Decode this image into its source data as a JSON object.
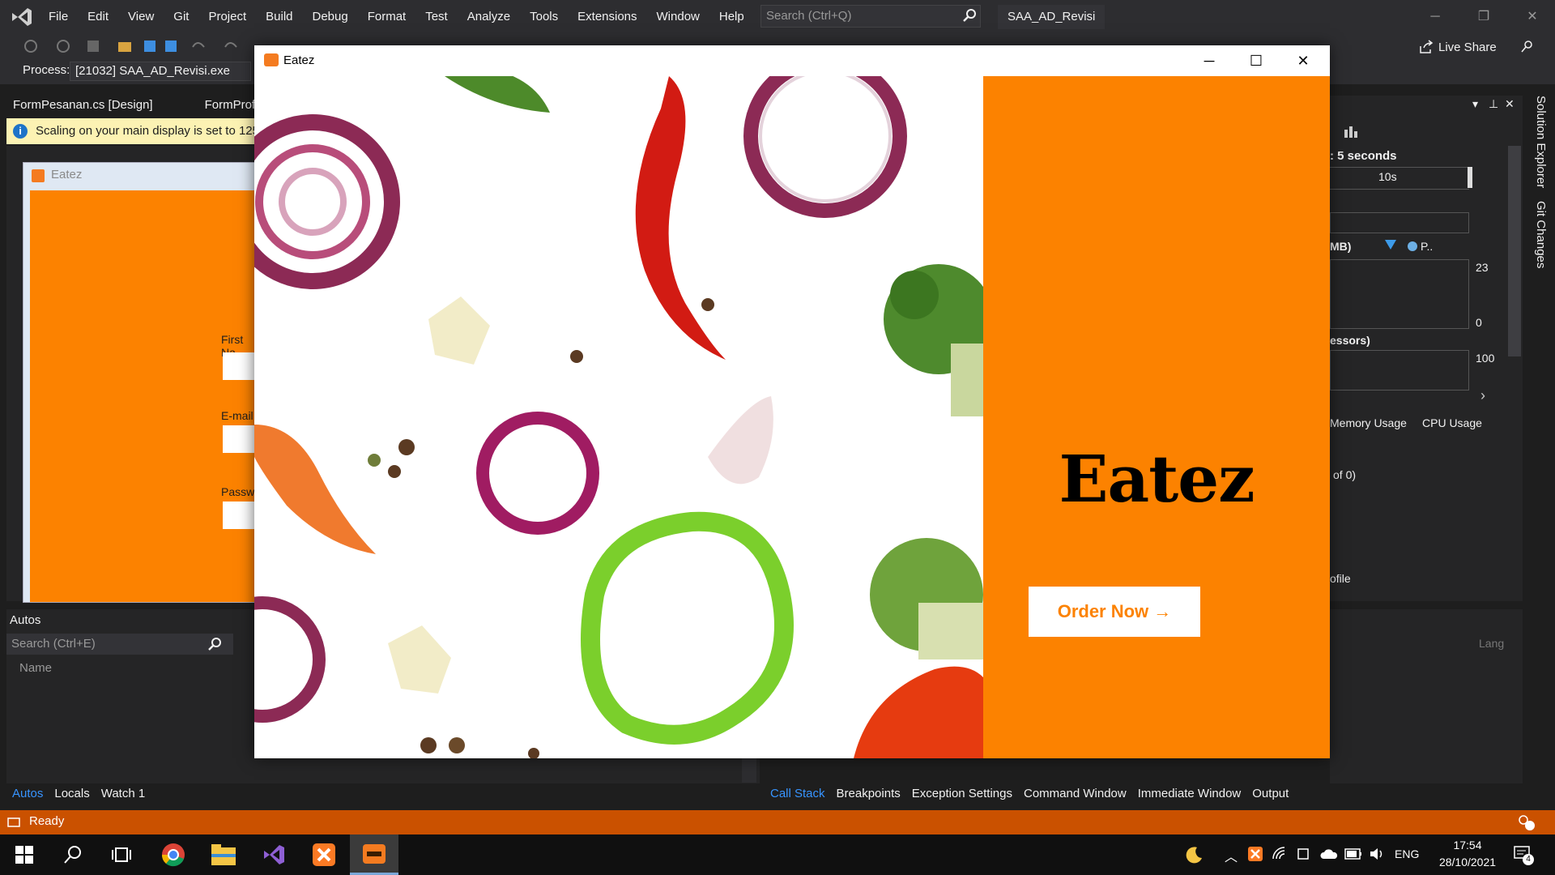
{
  "vs": {
    "menu": [
      "File",
      "Edit",
      "View",
      "Git",
      "Project",
      "Build",
      "Debug",
      "Format",
      "Test",
      "Analyze",
      "Tools",
      "Extensions",
      "Window",
      "Help"
    ],
    "search_placeholder": "Search (Ctrl+Q)",
    "solution_name": "SAA_AD_Revisi",
    "live_share": "Live Share",
    "process_label": "Process:",
    "process_value": "[21032] SAA_AD_Revisi.exe",
    "doc_tabs": [
      "FormPesanan.cs [Design]",
      "FormProfil..."
    ],
    "info_bar_text": "Scaling on your main display is set to 125",
    "designer": {
      "form_title": "Eatez",
      "labels": [
        "First Na",
        "E-mail",
        "Passwo"
      ]
    },
    "autos": {
      "title": "Autos",
      "search_placeholder": "Search (Ctrl+E)",
      "column_name": "Name"
    },
    "bottom_tabs_left": [
      "Autos",
      "Locals",
      "Watch 1"
    ],
    "bottom_tabs_right": [
      "Call Stack",
      "Breakpoints",
      "Exception Settings",
      "Command Window",
      "Immediate Window",
      "Output"
    ],
    "right_panel": {
      "seconds": ": 5 seconds",
      "tick": "10s",
      "mb_label": "MB)",
      "p_label": "P..",
      "val_23": "23",
      "val_0": "0",
      "processors": "essors)",
      "val_100": "100",
      "tabs": [
        "Memory Usage",
        "CPU Usage"
      ],
      "of_0": "of 0)",
      "profile": "ofile",
      "lang": "Lang"
    },
    "side_tabs": [
      "Solution Explorer",
      "Git Changes"
    ],
    "status": "Ready"
  },
  "eatez": {
    "window_title": "Eatez",
    "logo": "Eatez",
    "order_button": "Order Now →",
    "brand_color": "#fc8200"
  },
  "taskbar": {
    "lang": "ENG",
    "time": "17:54",
    "date": "28/10/2021",
    "notification_count": "4"
  }
}
